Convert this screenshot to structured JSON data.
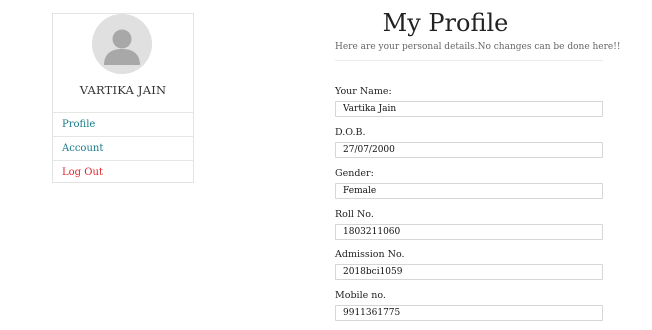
{
  "sidebar": {
    "user_name": "VARTIKA JAIN",
    "nav": [
      {
        "label": "Profile",
        "color": "#177a8a"
      },
      {
        "label": "Account",
        "color": "#177a8a"
      },
      {
        "label": "Log Out",
        "color": "#e0242b"
      }
    ]
  },
  "main": {
    "title": "My Profile",
    "subtitle": "Here are your personal details.No changes can be done here!!",
    "fields": [
      {
        "label": "Your Name:",
        "value": "Vartika Jain"
      },
      {
        "label": "D.O.B.",
        "value": "27/07/2000"
      },
      {
        "label": "Gender:",
        "value": "Female"
      },
      {
        "label": "Roll No.",
        "value": "1803211060"
      },
      {
        "label": "Admission No.",
        "value": "2018bci1059"
      },
      {
        "label": "Mobile no.",
        "value": "9911361775"
      }
    ]
  },
  "icons": {
    "avatar": "user-avatar-icon"
  }
}
